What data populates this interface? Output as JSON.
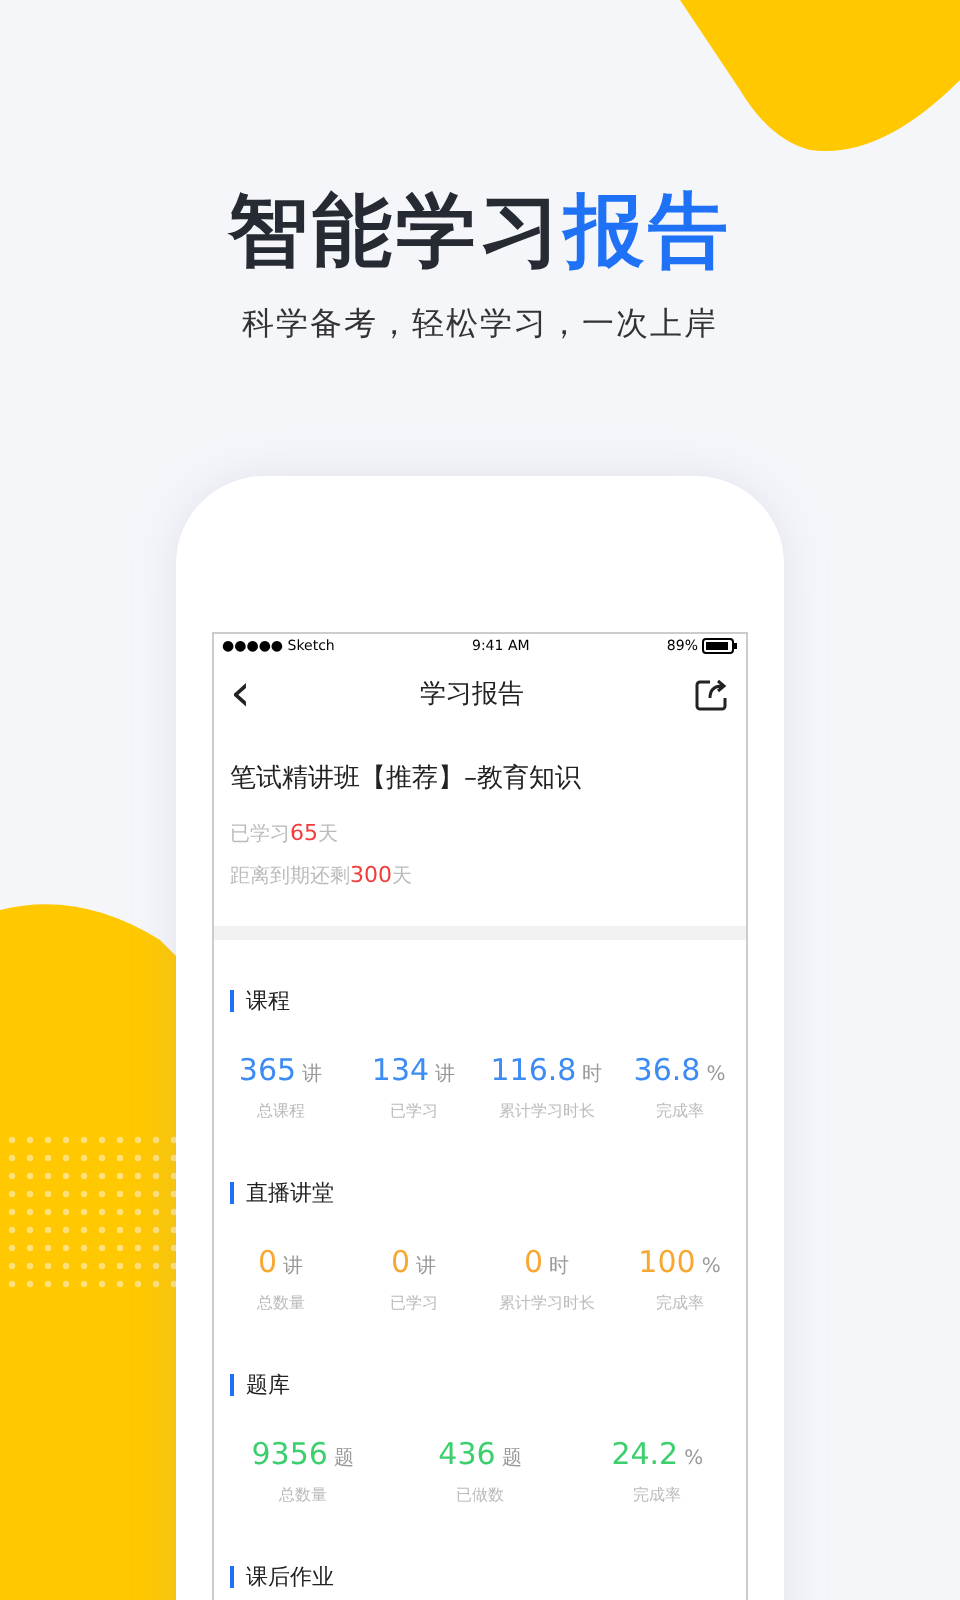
{
  "headline": {
    "text": "智能学习",
    "highlight": "报告"
  },
  "subtitle": "科学备考，轻松学习，一次上岸",
  "status_bar": {
    "carrier": "●●●●● Sketch",
    "time": "9:41 AM",
    "battery": "89%"
  },
  "nav_bar": {
    "back": "‹",
    "title": "学习报告"
  },
  "course": {
    "title": "笔试精讲班【推荐】–教育知识",
    "lines": [
      {
        "prefix": "已学习",
        "number": "65",
        "suffix": "天"
      },
      {
        "prefix": "距离到期还剩",
        "number": "300",
        "suffix": "天"
      }
    ]
  },
  "sections": [
    {
      "title": "课程",
      "color": "#3d8bf5",
      "stats": [
        {
          "value": "365",
          "unit": "讲",
          "label": "总课程"
        },
        {
          "value": "134",
          "unit": "讲",
          "label": "已学习"
        },
        {
          "value": "116.8",
          "unit": "时",
          "label": "累计学习时长"
        },
        {
          "value": "36.8",
          "unit": "%",
          "label": "完成率"
        }
      ]
    },
    {
      "title": "直播讲堂",
      "color": "#f7a833",
      "stats": [
        {
          "value": "0",
          "unit": "讲",
          "label": "总数量"
        },
        {
          "value": "0",
          "unit": "讲",
          "label": "已学习"
        },
        {
          "value": "0",
          "unit": "时",
          "label": "累计学习时长"
        },
        {
          "value": "100",
          "unit": "%",
          "label": "完成率"
        }
      ]
    },
    {
      "title": "题库",
      "color": "#3ccf6e",
      "stats": [
        {
          "value": "9356",
          "unit": "题",
          "label": "总数量"
        },
        {
          "value": "436",
          "unit": "题",
          "label": "已做数"
        },
        {
          "value": "24.2",
          "unit": "%",
          "label": "完成率"
        }
      ]
    },
    {
      "title": "课后作业"
    }
  ]
}
